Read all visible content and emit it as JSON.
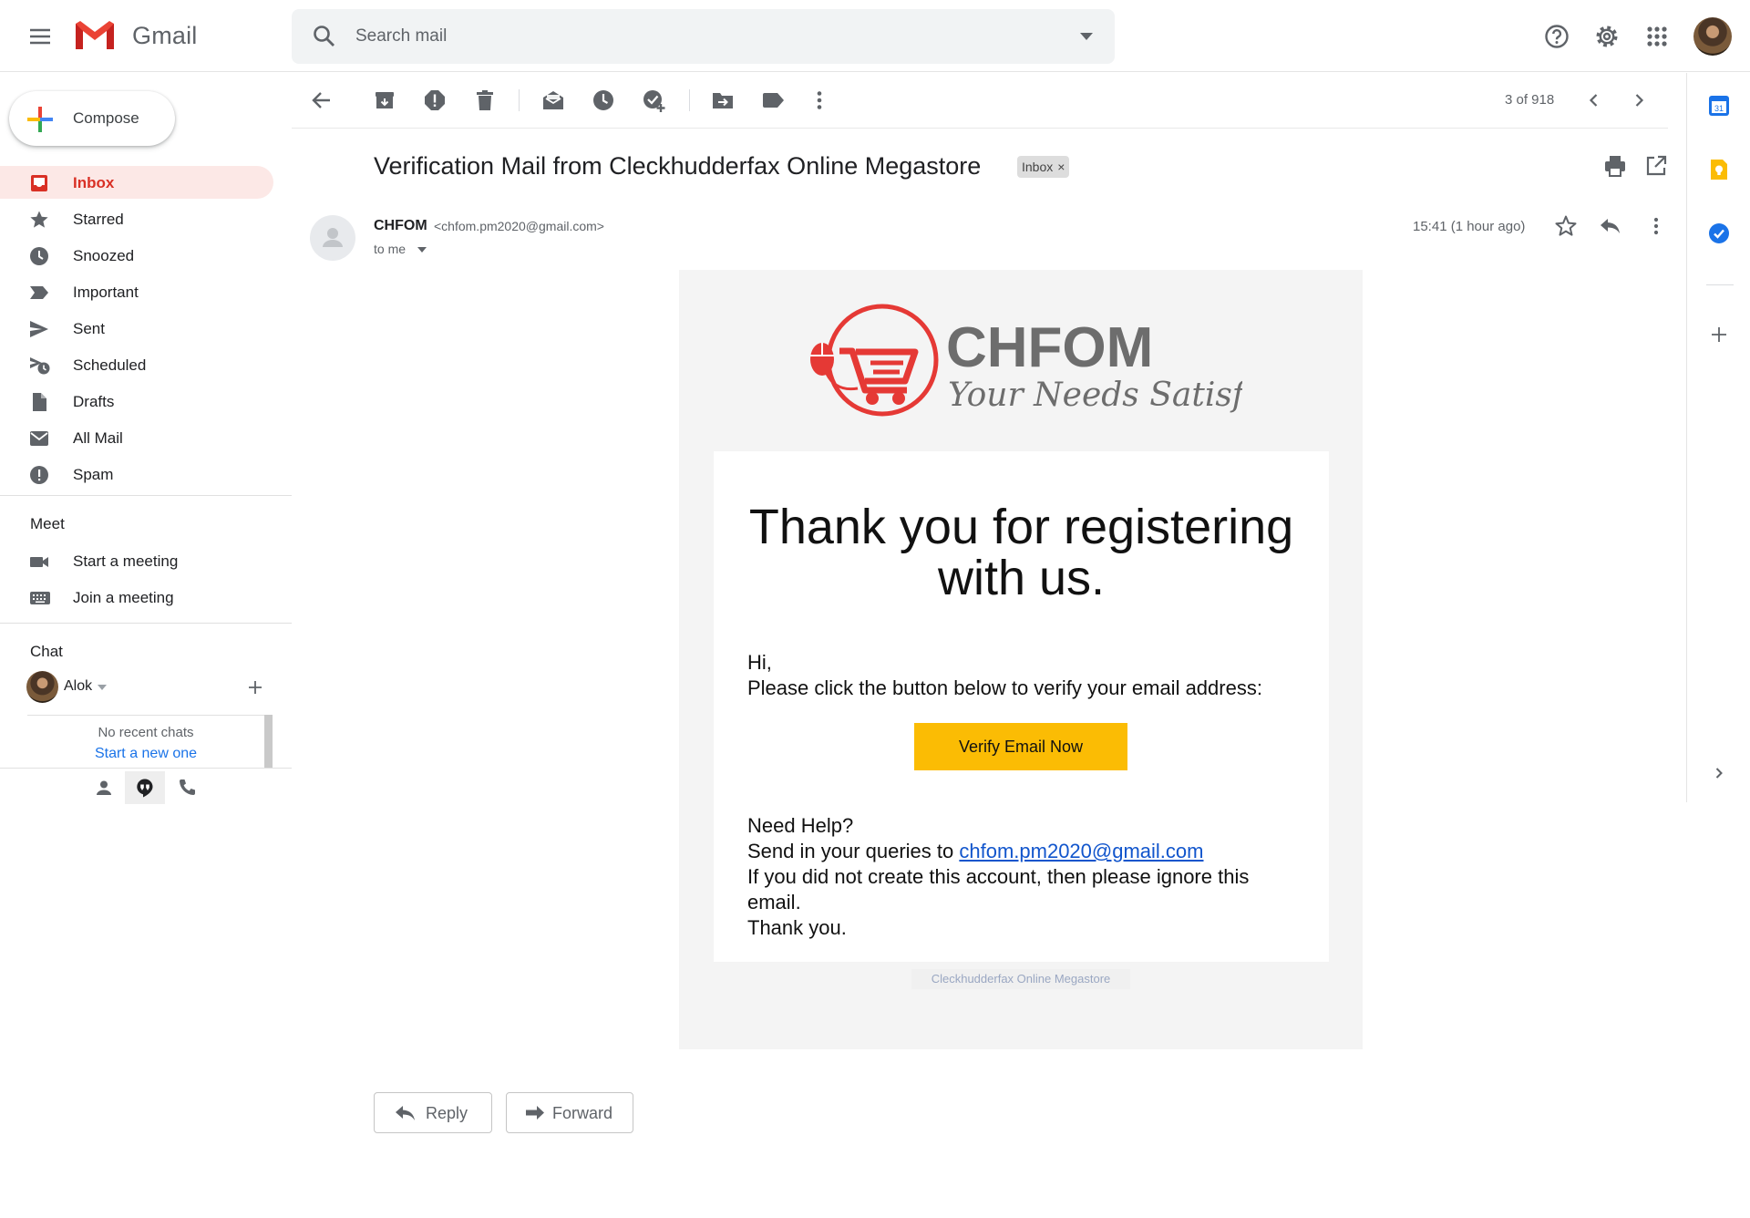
{
  "app": {
    "name": "Gmail"
  },
  "search": {
    "placeholder": "Search mail"
  },
  "compose": {
    "label": "Compose"
  },
  "sidebar": {
    "items": [
      {
        "label": "Inbox",
        "icon": "inbox-icon",
        "active": true
      },
      {
        "label": "Starred",
        "icon": "star-icon"
      },
      {
        "label": "Snoozed",
        "icon": "clock-icon"
      },
      {
        "label": "Important",
        "icon": "important-icon"
      },
      {
        "label": "Sent",
        "icon": "send-icon"
      },
      {
        "label": "Scheduled",
        "icon": "scheduled-icon"
      },
      {
        "label": "Drafts",
        "icon": "draft-icon"
      },
      {
        "label": "All Mail",
        "icon": "mail-icon"
      },
      {
        "label": "Spam",
        "icon": "spam-icon"
      }
    ]
  },
  "meet": {
    "title": "Meet",
    "items": [
      {
        "label": "Start a meeting",
        "icon": "video-camera-icon"
      },
      {
        "label": "Join a meeting",
        "icon": "keyboard-icon"
      }
    ]
  },
  "chat": {
    "title": "Chat",
    "user": "Alok",
    "empty_text": "No recent chats",
    "start_new": "Start a new one"
  },
  "toolbar": {
    "pager": "3 of 918"
  },
  "message": {
    "subject": "Verification Mail from Cleckhudderfax Online Megastore",
    "label": "Inbox",
    "label_close": "×",
    "sender_name": "CHFOM",
    "sender_email": "<chfom.pm2020@gmail.com>",
    "to": "to me",
    "time": "15:41 (1 hour ago)"
  },
  "email": {
    "brand": "CHFOM",
    "tagline": "Your Needs Satisfied",
    "heading": "Thank you for registering with us.",
    "greeting": "Hi,",
    "instruction": "Please click the button below to verify your email address:",
    "button": "Verify Email Now",
    "help_title": "Need Help?",
    "help_prefix": "Send in your queries to ",
    "help_email": "chfom.pm2020@gmail.com",
    "ignore_note": "If you did not create this account, then please ignore this email.",
    "thanks": "Thank you.",
    "footer": "Cleckhudderfax Online Megastore"
  },
  "actions": {
    "reply": "Reply",
    "forward": "Forward"
  },
  "colors": {
    "accent_red": "#d93025",
    "active_bg": "#fce8e6",
    "verify_button": "#fbbc04",
    "link": "#1155cc",
    "brand_red": "#e53935",
    "brand_gray": "#6d6d6d"
  }
}
